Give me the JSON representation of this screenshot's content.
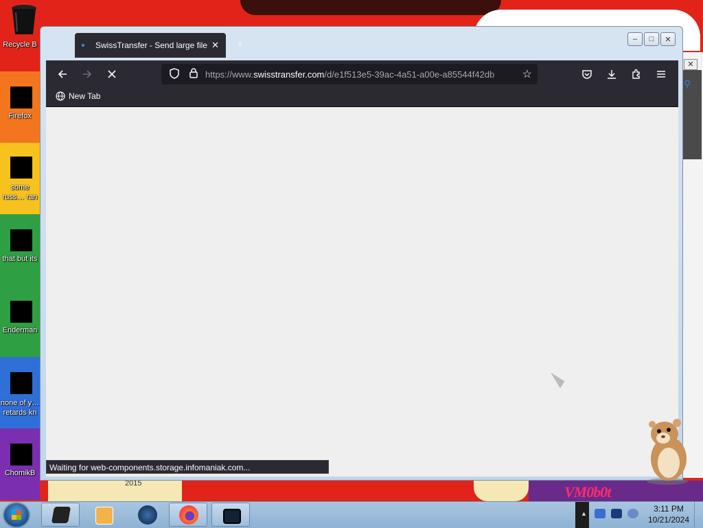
{
  "desktop": {
    "icons": [
      {
        "label": "Recycle B"
      },
      {
        "label": "Firefox"
      },
      {
        "label": "some russ… ran a ra"
      },
      {
        "label": "that but its"
      },
      {
        "label": "Enderman"
      },
      {
        "label": "none of y… retards kn"
      },
      {
        "label": "ChomikB"
      }
    ],
    "wallpaper_text": {
      "brand": "VM0b0t",
      "year": "2015"
    },
    "colors": [
      "#e2231a",
      "#f39c12",
      "#f7d21e",
      "#2ea043",
      "#2f6fd8",
      "#7b2fb0",
      "#6a2a8a"
    ]
  },
  "browser": {
    "tab": {
      "title": "SwissTransfer - Send large files securely"
    },
    "window_controls": {
      "minimize": "–",
      "maximize": "□",
      "close": "✕"
    },
    "toolbar": {
      "back_icon": "arrow-left-icon",
      "forward_icon": "arrow-right-icon",
      "stop_icon": "close-icon",
      "url_scheme": "https://www.",
      "url_host": "swisstransfer.com",
      "url_path": "/d/e1f513e5-39ac-4a51-a00e-a85544f42db"
    },
    "bookmarks": [
      {
        "label": "New Tab"
      }
    ],
    "status_text": "Waiting for web-components.storage.infomaniak.com..."
  },
  "taskbar": {
    "clock_time": "3:11 PM",
    "clock_date": "10/21/2024"
  }
}
